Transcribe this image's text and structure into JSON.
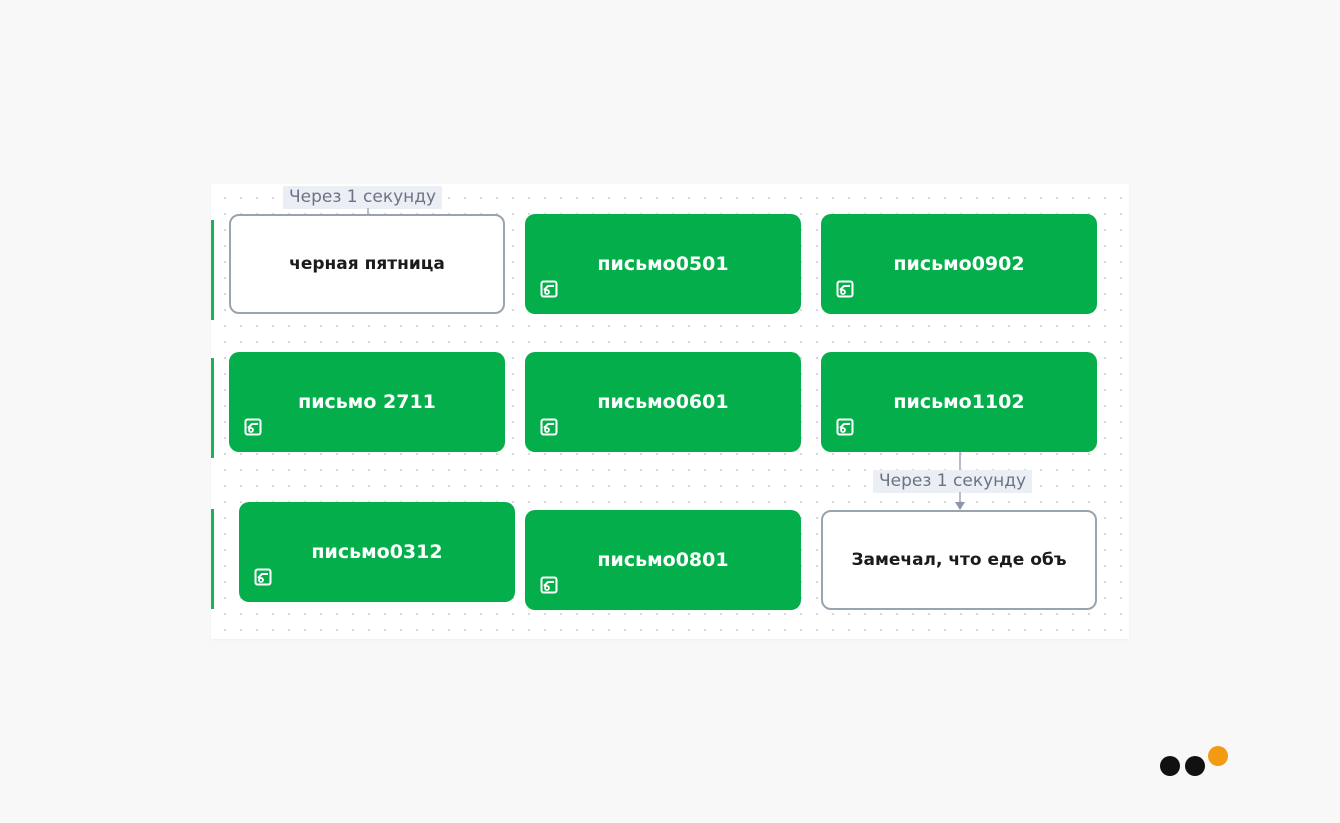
{
  "colors": {
    "node_green": "#04af4b",
    "node_white_border": "#9aa3b3",
    "delay_bg": "#eceef6",
    "logo_orange": "#f39a13",
    "logo_black": "#111111"
  },
  "nodes": [
    {
      "id": "node-chernaya-pyatnitsa",
      "label": "черная пятница",
      "style": "white"
    },
    {
      "id": "node-pismo0501",
      "label": "письмо0501",
      "style": "green",
      "icon": "email-template-icon"
    },
    {
      "id": "node-pismo0902",
      "label": "письмо0902",
      "style": "green",
      "icon": "email-template-icon"
    },
    {
      "id": "node-pismo-2711",
      "label": "письмо 2711",
      "style": "green",
      "icon": "email-template-icon"
    },
    {
      "id": "node-pismo0601",
      "label": "письмо0601",
      "style": "green",
      "icon": "email-template-icon"
    },
    {
      "id": "node-pismo1102",
      "label": "письмо1102",
      "style": "green",
      "icon": "email-template-icon"
    },
    {
      "id": "node-pismo0312",
      "label": "письмо0312",
      "style": "green",
      "icon": "email-template-icon"
    },
    {
      "id": "node-pismo0801",
      "label": "письмо0801",
      "style": "green",
      "icon": "email-template-icon"
    },
    {
      "id": "node-zamechal",
      "label": "Замечал, что еде объ",
      "style": "white"
    }
  ],
  "delays": [
    {
      "label": "Через 1 секунду"
    },
    {
      "label": "Через 1 секунду"
    }
  ]
}
